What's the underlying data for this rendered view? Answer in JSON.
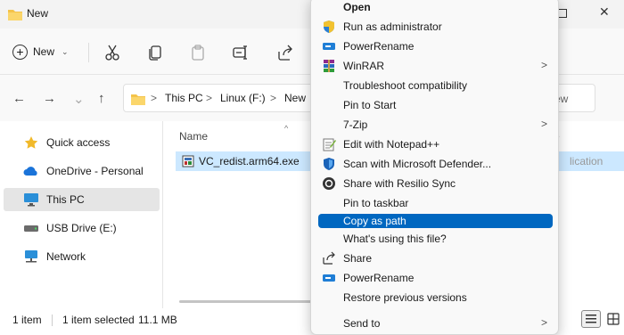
{
  "window": {
    "title": "New"
  },
  "toolbar": {
    "new_label": "New"
  },
  "breadcrumb": {
    "items": [
      "This PC",
      "Linux (F:)",
      "New"
    ],
    "separator": ">"
  },
  "search": {
    "placeholder_fragment": "ew"
  },
  "nav": {
    "back": "←",
    "forward": "→",
    "up": "↑",
    "items": [
      {
        "label": "Quick access"
      },
      {
        "label": "OneDrive - Personal"
      },
      {
        "label": "This PC"
      },
      {
        "label": "USB Drive (E:)"
      },
      {
        "label": "Network"
      }
    ]
  },
  "files": {
    "column_name": "Name",
    "column_type_fragment": "e",
    "row": {
      "name": "VC_redist.arm64.exe",
      "type_fragment": "lication"
    }
  },
  "status": {
    "count": "1 item",
    "selected": "1 item selected",
    "size": "11.1 MB"
  },
  "context_menu": {
    "items": [
      {
        "label": "Open",
        "icon": "none"
      },
      {
        "label": "Run as administrator",
        "icon": "shield-icon"
      },
      {
        "label": "PowerRename",
        "icon": "powerrename-icon"
      },
      {
        "label": "WinRAR",
        "icon": "winrar-icon",
        "submenu": ">"
      },
      {
        "label": "Troubleshoot compatibility",
        "icon": "none"
      },
      {
        "label": "Pin to Start",
        "icon": "none"
      },
      {
        "label": "7-Zip",
        "icon": "none",
        "submenu": ">"
      },
      {
        "label": "Edit with Notepad++",
        "icon": "notepad-icon"
      },
      {
        "label": "Scan with Microsoft Defender...",
        "icon": "defender-icon"
      },
      {
        "label": "Share with Resilio Sync",
        "icon": "resilio-icon"
      },
      {
        "label": "Pin to taskbar",
        "icon": "none"
      },
      {
        "label": "Copy as path",
        "icon": "none",
        "highlighted": true
      },
      {
        "label": "What's using this file?",
        "icon": "none"
      },
      {
        "label": "Share",
        "icon": "share-icon"
      },
      {
        "label": "PowerRename",
        "icon": "powerrename-icon"
      },
      {
        "label": "Restore previous versions",
        "icon": "none"
      },
      {
        "label": "Send to",
        "icon": "none",
        "submenu": ">"
      }
    ]
  },
  "colors": {
    "accent": "#0067c0",
    "selection": "#cce8ff",
    "folder": "#f4c34a"
  }
}
